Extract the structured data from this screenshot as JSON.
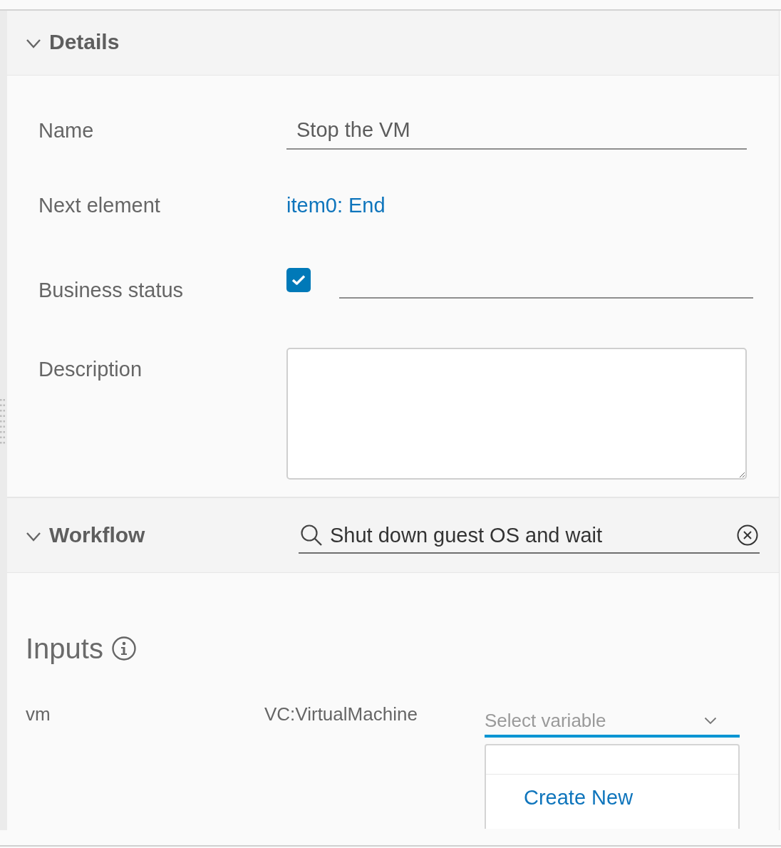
{
  "details": {
    "title": "Details",
    "expanded": true,
    "fields": [
      {
        "kind": "text",
        "label": "Name",
        "value": "Stop the VM"
      },
      {
        "kind": "link",
        "label": "Next element",
        "value": "item0: End"
      },
      {
        "kind": "checkbox",
        "label": "Business status",
        "checked": true
      },
      {
        "kind": "textarea",
        "label": "Description"
      }
    ]
  },
  "workflow": {
    "title": "Workflow",
    "expanded": true,
    "search": {
      "value": "Shut down guest OS and wait"
    },
    "inputs": {
      "title": "Inputs",
      "rows": [
        {
          "name": "vm",
          "type": "VC:VirtualMachine",
          "select": {
            "placeholder": "Select variable",
            "open": true,
            "options": [
              "Create New"
            ]
          }
        }
      ]
    }
  }
}
